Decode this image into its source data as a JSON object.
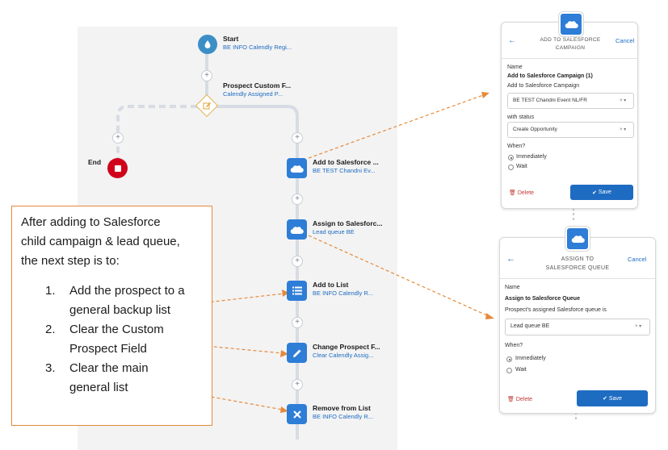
{
  "flow": {
    "start": {
      "title": "Start",
      "subtitle": "BE INFO Calendly Regi..."
    },
    "branch": {
      "title": "Prospect Custom F...",
      "subtitle": "Calendly Assigned P..."
    },
    "end": {
      "title": "End"
    },
    "steps": [
      {
        "title": "Add to Salesforce ...",
        "subtitle": "BE TEST Chandni Ev...",
        "icon": "salesforce-cloud-icon"
      },
      {
        "title": "Assign to Salesforc...",
        "subtitle": "Lead queue BE",
        "icon": "salesforce-cloud-icon"
      },
      {
        "title": "Add to List",
        "subtitle": "BE INFO Calendly R...",
        "icon": "list-icon"
      },
      {
        "title": "Change Prospect F...",
        "subtitle": "Clear Calendly Assig...",
        "icon": "pencil-icon"
      },
      {
        "title": "Remove from List",
        "subtitle": "BE INFO Calendly R...",
        "icon": "x-icon"
      }
    ]
  },
  "campaign_panel": {
    "header_line1": "ADD TO SALESFORCE",
    "header_line2": "CAMPAIGN",
    "cancel": "Cancel",
    "name_label": "Name",
    "name_value": "Add to Salesforce Campaign (1)",
    "campaign_label": "Add to Salesforce Campaign",
    "campaign_value": "BE TEST Chandni Event NL/FR",
    "status_label": "with status",
    "status_value": "Create Opportunity",
    "when_label": "When?",
    "option_immediately": "Immediately",
    "option_wait": "Wait",
    "delete": "Delete",
    "save": "Save"
  },
  "queue_panel": {
    "header_line1": "ASSIGN TO",
    "header_line2": "SALESFORCE QUEUE",
    "cancel": "Cancel",
    "name_label": "Name",
    "name_value": "Assign to Salesforce Queue",
    "queue_label": "Prospect's assigned Salesforce queue is",
    "queue_value": "Lead queue BE",
    "when_label": "When?",
    "option_immediately": "Immediately",
    "option_wait": "Wait",
    "delete": "Delete",
    "save": "Save"
  },
  "callout": {
    "intro_lines": [
      "After adding to Salesforce",
      "child campaign & lead queue,",
      "the next step is to:"
    ],
    "items": [
      {
        "num": "1.",
        "lines": [
          "Add the prospect to a",
          "general backup list"
        ]
      },
      {
        "num": "2.",
        "lines": [
          "Clear the Custom",
          "Prospect Field"
        ]
      },
      {
        "num": "3.",
        "lines": [
          "Clear the main",
          "general list"
        ]
      }
    ]
  },
  "colors": {
    "accent_blue": "#2e7dd7",
    "end_red": "#d0021b",
    "start_teal": "#3c8fc6",
    "annotation_orange": "#e58a3a"
  }
}
